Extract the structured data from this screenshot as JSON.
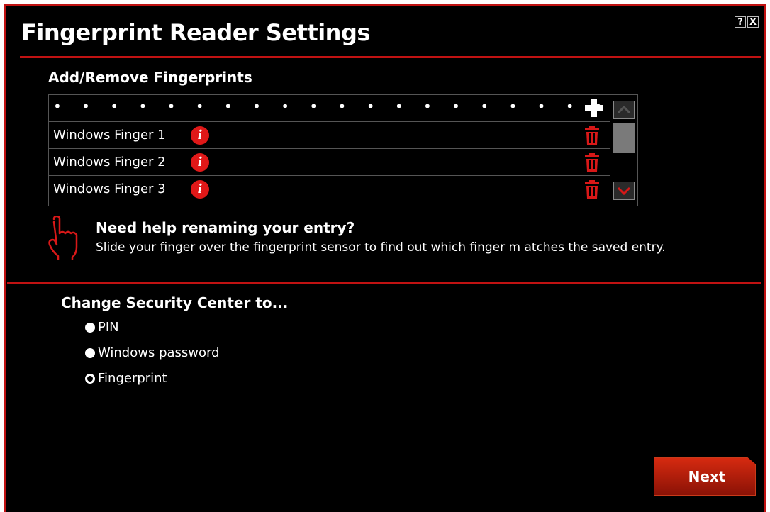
{
  "window": {
    "title": "Fingerprint Reader Settings",
    "help_button": "?",
    "close_button": "X"
  },
  "fingerprints": {
    "heading": "Add/Remove Fingerprints",
    "password_mask": "• • • • • • • • • • • • • • • • • • • •",
    "items": [
      {
        "label": "Windows Finger 1"
      },
      {
        "label": "Windows Finger 2"
      },
      {
        "label": "Windows Finger 3"
      }
    ]
  },
  "help": {
    "title": "Need help renaming your entry?",
    "body": "Slide your finger over the fingerprint sensor to find out which finger m atches the saved entry."
  },
  "security": {
    "heading": "Change Security Center to...",
    "options": [
      {
        "label": "PIN",
        "selected": false
      },
      {
        "label": "Windows password",
        "selected": false
      },
      {
        "label": "Fingerprint",
        "selected": true
      }
    ]
  },
  "footer": {
    "next_label": "Next"
  },
  "colors": {
    "accent": "#c01212",
    "background": "#000000",
    "button": "#c62810"
  }
}
